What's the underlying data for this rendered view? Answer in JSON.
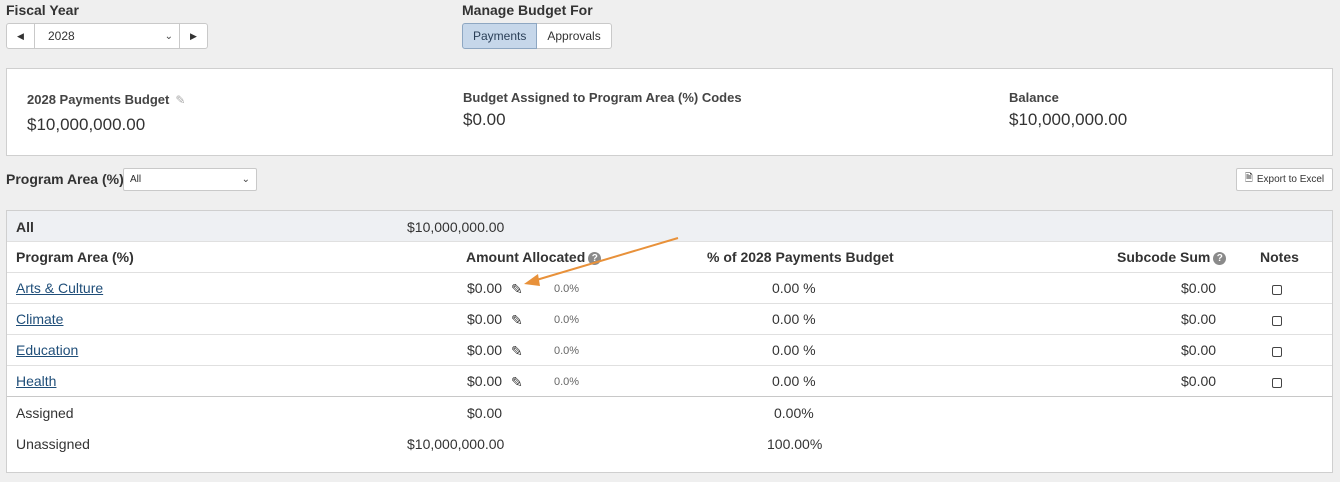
{
  "fiscal_year": {
    "label": "Fiscal Year",
    "selected": "2028",
    "prev_icon": "caret-left-icon",
    "next_icon": "caret-right-icon"
  },
  "manage_budget": {
    "label": "Manage Budget For",
    "options": [
      "Payments",
      "Approvals"
    ],
    "selected": "Payments"
  },
  "summary": {
    "budget_title": "2028 Payments Budget",
    "budget_value": "$10,000,000.00",
    "assigned_title": "Budget Assigned to Program Area (%) Codes",
    "assigned_value": "$0.00",
    "balance_title": "Balance",
    "balance_value": "$10,000,000.00"
  },
  "filter": {
    "label": "Program Area (%):",
    "selected": "All",
    "export_label": "Export to Excel"
  },
  "table": {
    "group_label": "All",
    "group_total": "$10,000,000.00",
    "headers": {
      "program_area": "Program Area (%)",
      "amount_allocated": "Amount Allocated",
      "percent_budget": "% of 2028 Payments Budget",
      "subcode_sum": "Subcode Sum",
      "notes": "Notes"
    },
    "rows": [
      {
        "name": "Arts & Culture",
        "amount": "$0.00",
        "small_pct": "0.0%",
        "percent": "0.00 %",
        "subcode_sum": "$0.00"
      },
      {
        "name": "Climate",
        "amount": "$0.00",
        "small_pct": "0.0%",
        "percent": "0.00 %",
        "subcode_sum": "$0.00"
      },
      {
        "name": "Education",
        "amount": "$0.00",
        "small_pct": "0.0%",
        "percent": "0.00 %",
        "subcode_sum": "$0.00"
      },
      {
        "name": "Health",
        "amount": "$0.00",
        "small_pct": "0.0%",
        "percent": "0.00 %",
        "subcode_sum": "$0.00"
      }
    ],
    "assigned": {
      "label": "Assigned",
      "amount": "$0.00",
      "percent": "0.00%"
    },
    "unassigned": {
      "label": "Unassigned",
      "amount": "$10,000,000.00",
      "percent": "100.00%"
    }
  },
  "annotation": {
    "color": "#e8913a"
  }
}
